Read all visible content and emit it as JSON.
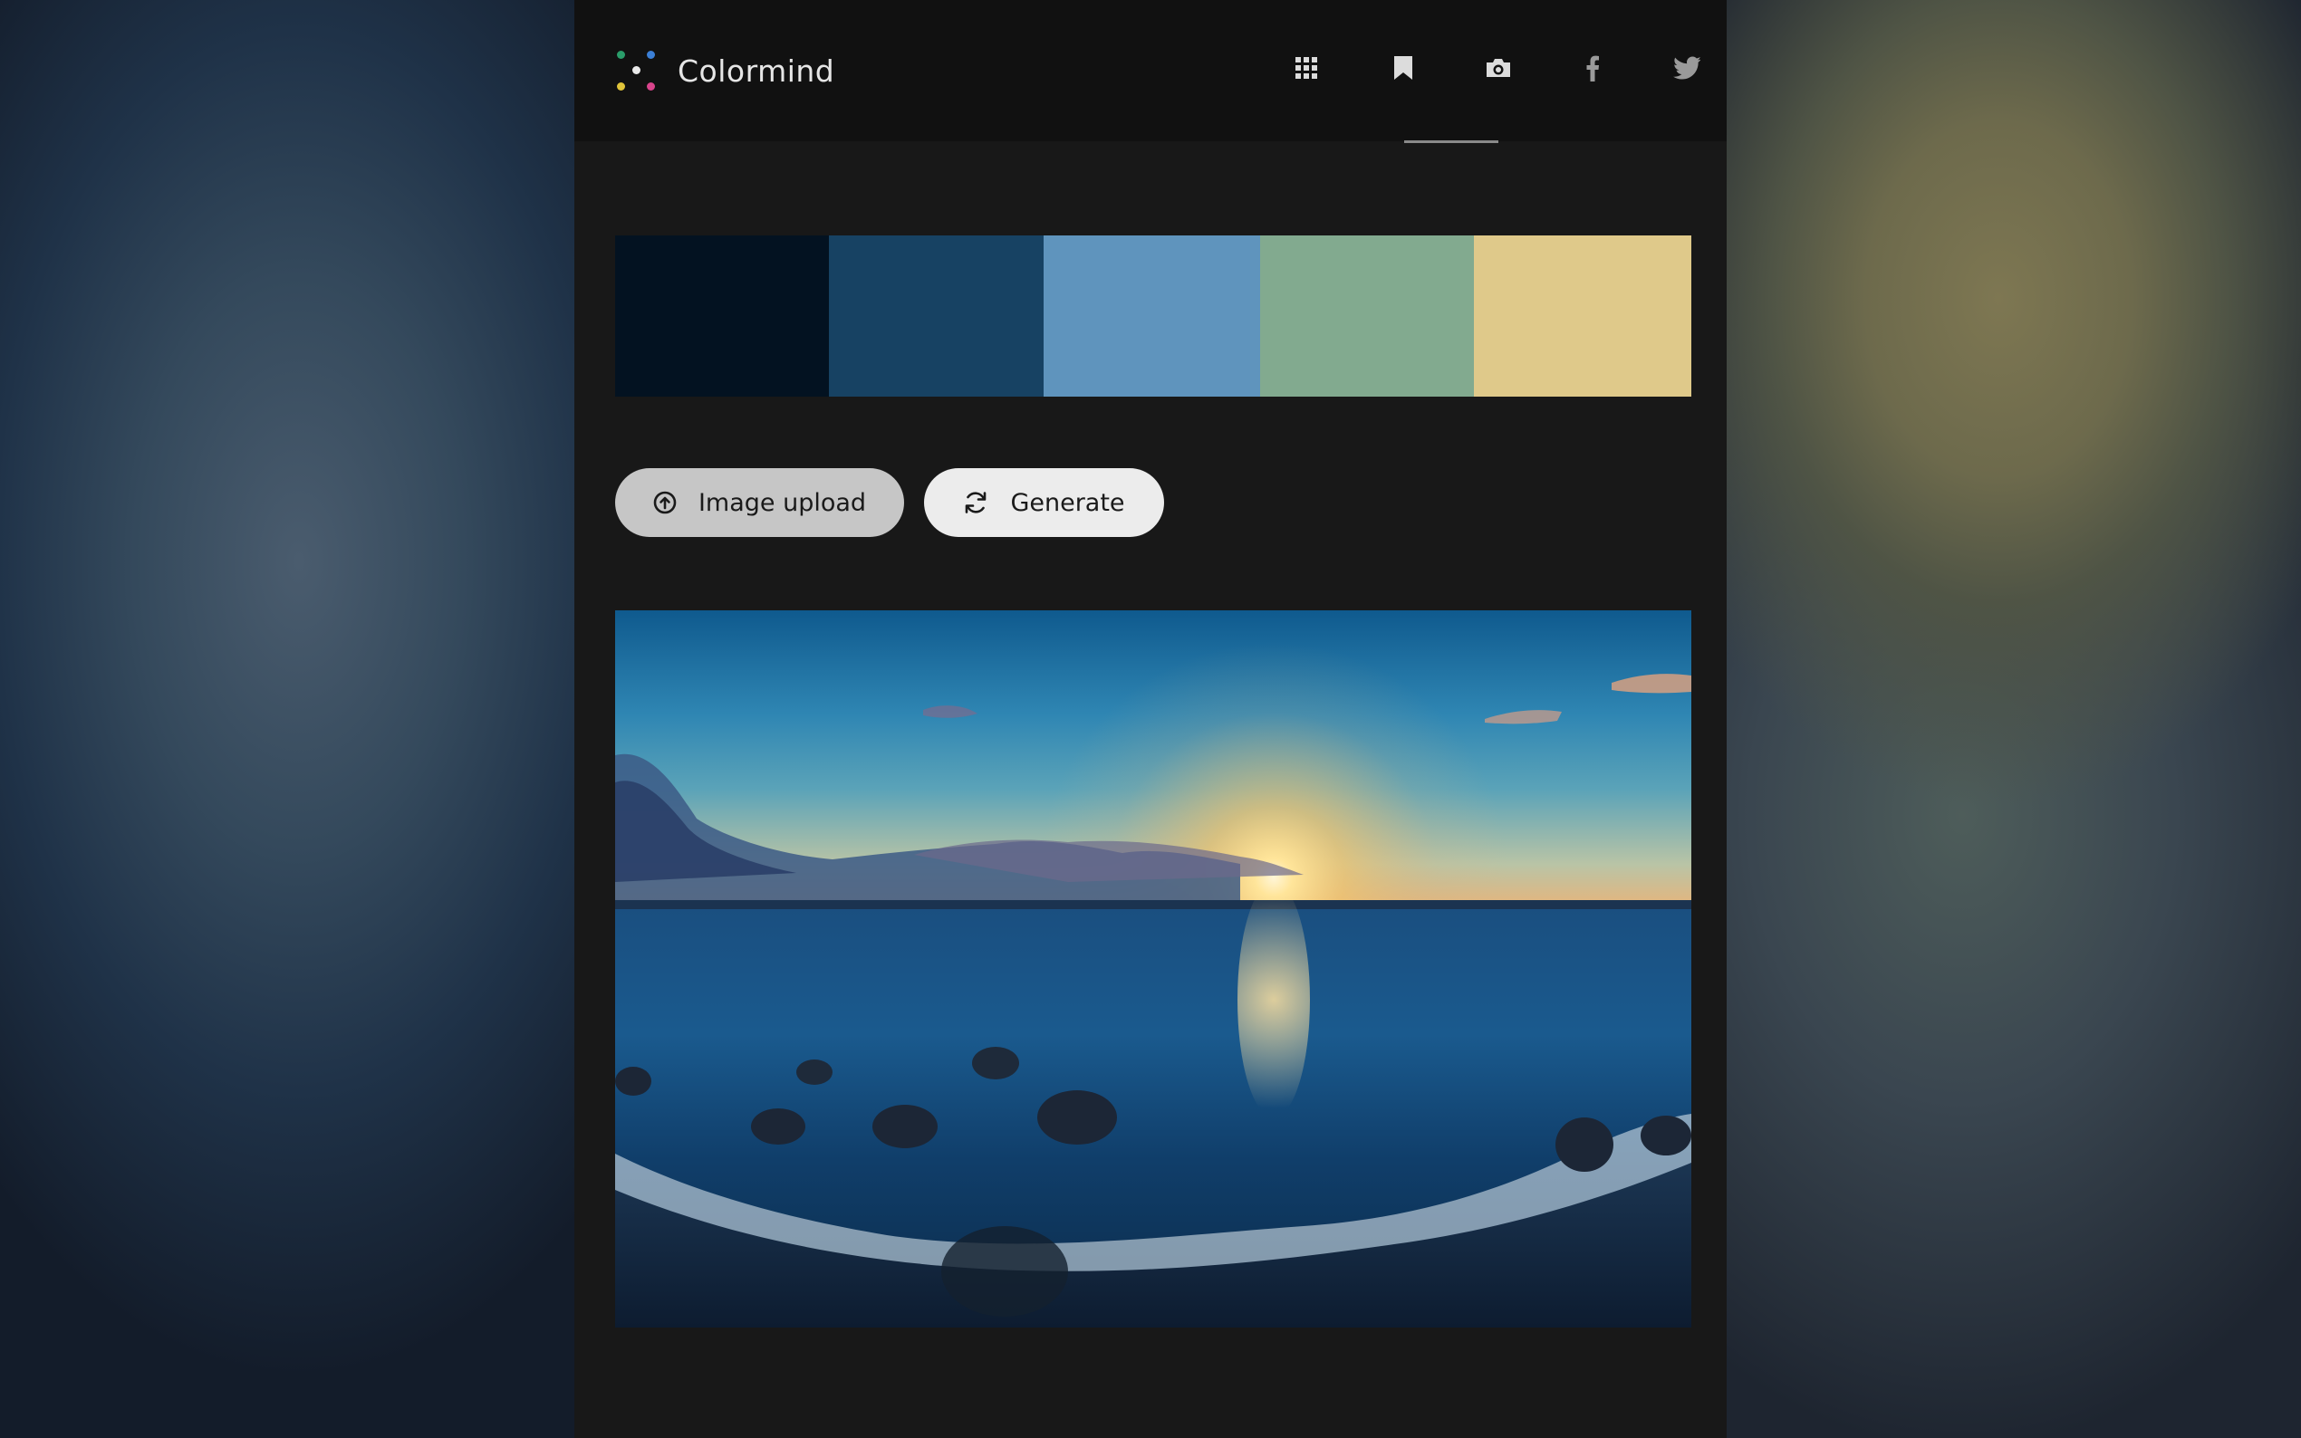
{
  "app": {
    "name": "Colormind"
  },
  "nav": {
    "items": [
      {
        "icon": "grid-icon",
        "active": false
      },
      {
        "icon": "bookmark-icon",
        "active": false
      },
      {
        "icon": "camera-icon",
        "active": true
      },
      {
        "icon": "facebook-icon",
        "active": false
      },
      {
        "icon": "twitter-icon",
        "active": false
      }
    ]
  },
  "palette": {
    "colors": [
      "#031221",
      "#174263",
      "#5f94bd",
      "#82aa8f",
      "#dfc98a"
    ]
  },
  "buttons": {
    "upload_label": "Image upload",
    "upload_icon": "upload-circle-icon",
    "generate_label": "Generate",
    "generate_icon": "refresh-icon"
  },
  "image": {
    "subject": "photo-sunset-beach"
  }
}
